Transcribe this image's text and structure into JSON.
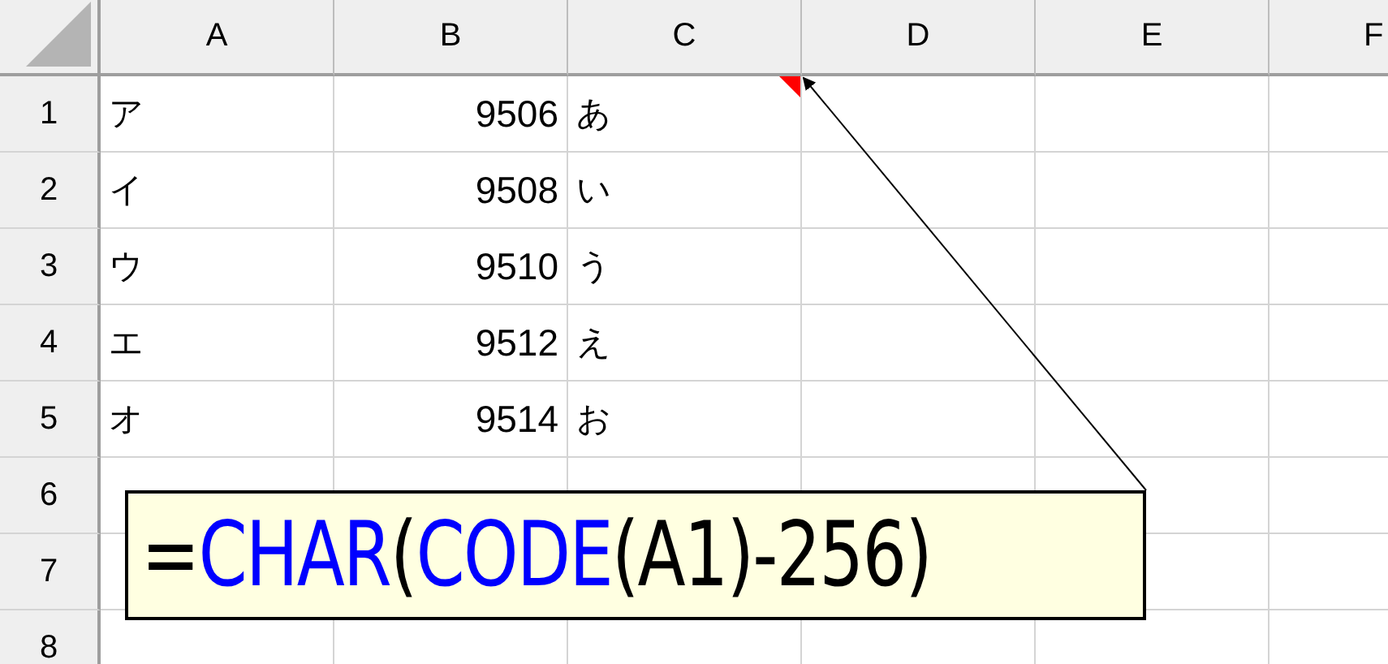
{
  "columns": [
    {
      "label": "A",
      "kind": "text"
    },
    {
      "label": "B",
      "kind": "number"
    },
    {
      "label": "C",
      "kind": "text"
    },
    {
      "label": "D",
      "kind": "text"
    },
    {
      "label": "E",
      "kind": "text"
    },
    {
      "label": "F",
      "kind": "text"
    }
  ],
  "rows": [
    {
      "header": "1",
      "cells": [
        {
          "text": "ア",
          "commented": false
        },
        {
          "text": "9506",
          "commented": false
        },
        {
          "text": "あ",
          "commented": true
        }
      ]
    },
    {
      "header": "2",
      "cells": [
        {
          "text": "イ",
          "commented": false
        },
        {
          "text": "9508",
          "commented": false
        },
        {
          "text": "い",
          "commented": false
        }
      ]
    },
    {
      "header": "3",
      "cells": [
        {
          "text": "ウ",
          "commented": false
        },
        {
          "text": "9510",
          "commented": false
        },
        {
          "text": "う",
          "commented": false
        }
      ]
    },
    {
      "header": "4",
      "cells": [
        {
          "text": "エ",
          "commented": false
        },
        {
          "text": "9512",
          "commented": false
        },
        {
          "text": "え",
          "commented": false
        }
      ]
    },
    {
      "header": "5",
      "cells": [
        {
          "text": "オ",
          "commented": false
        },
        {
          "text": "9514",
          "commented": false
        },
        {
          "text": "お",
          "commented": false
        }
      ]
    },
    {
      "header": "6"
    },
    {
      "header": "7"
    },
    {
      "header": "8"
    }
  ],
  "comment": {
    "segments": [
      {
        "text": "=",
        "kind": "operator"
      },
      {
        "text": "CHAR",
        "kind": "function"
      },
      {
        "text": "(",
        "kind": "operator"
      },
      {
        "text": "CODE",
        "kind": "function"
      },
      {
        "text": "(A1)-256)",
        "kind": "operator"
      }
    ]
  }
}
